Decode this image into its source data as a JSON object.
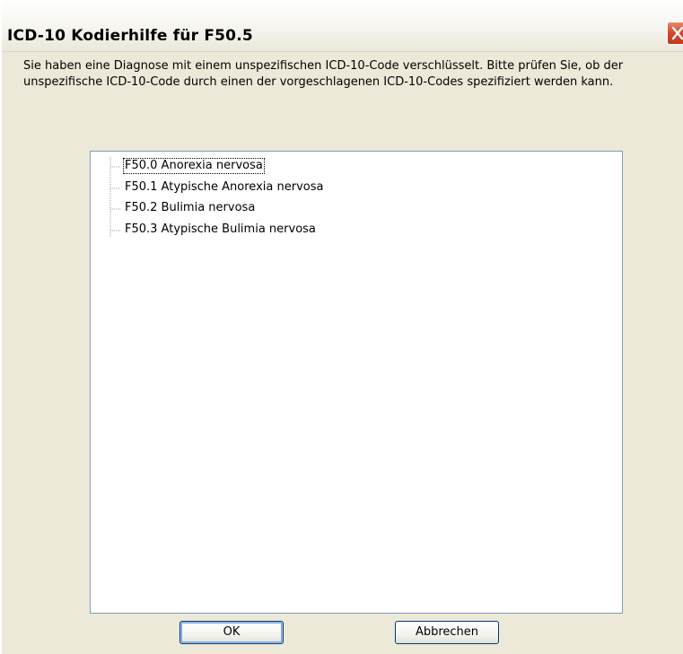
{
  "window": {
    "title": "ICD-10 Kodierhilfe für F50.5"
  },
  "message": "Sie haben eine Diagnose mit einem unspezifischen ICD-10-Code verschlüsselt. Bitte prüfen Sie, ob der unspezifische ICD-10-Code durch einen der vorgeschlagenen ICD-10-Codes spezifiziert werden kann.",
  "tree": {
    "items": [
      {
        "label": "F50.0 Anorexia nervosa",
        "selected": true
      },
      {
        "label": "F50.1 Atypische Anorexia nervosa",
        "selected": false
      },
      {
        "label": "F50.2 Bulimia nervosa",
        "selected": false
      },
      {
        "label": "F50.3 Atypische Bulimia nervosa",
        "selected": false
      }
    ]
  },
  "buttons": {
    "ok_label": "OK",
    "cancel_label": "Abbrechen"
  },
  "icons": {
    "close": "close-icon"
  },
  "colors": {
    "close_button": "#d4462a",
    "tree_border": "#7f9db9",
    "button_border": "#003c74"
  }
}
